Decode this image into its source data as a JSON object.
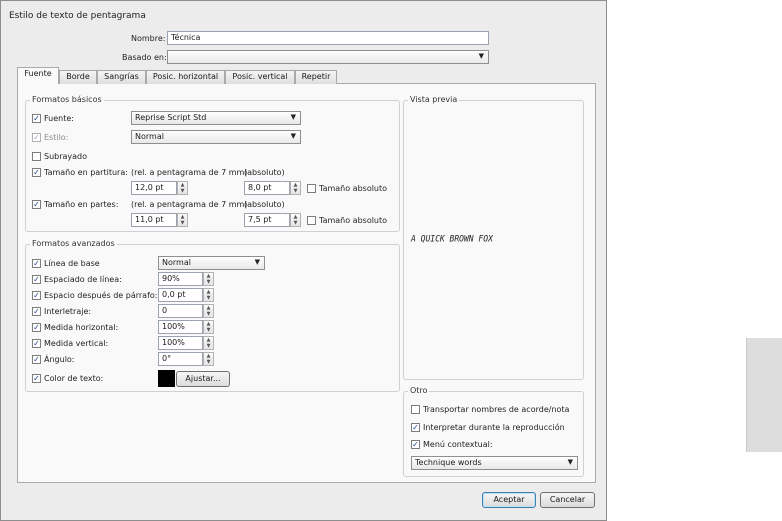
{
  "window": {
    "title": "Estilo de texto de pentagrama"
  },
  "header": {
    "name_label": "Nombre:",
    "name_value": "Técnica",
    "based_on_label": "Basado en:",
    "based_on_value": ""
  },
  "tabs": [
    {
      "label": "Fuente"
    },
    {
      "label": "Borde"
    },
    {
      "label": "Sangrías"
    },
    {
      "label": "Posic. horizontal"
    },
    {
      "label": "Posic. vertical"
    },
    {
      "label": "Repetir"
    }
  ],
  "basic": {
    "title": "Formatos básicos",
    "font_label": "Fuente:",
    "font_value": "Reprise Script Std",
    "style_label": "Estilo:",
    "style_value": "Normal",
    "underline_label": "Subrayado",
    "score_size_label": "Tamaño en partitura:",
    "parts_size_label": "Tamaño en partes:",
    "rel_note": "(rel. a pentagrama de 7 mm)",
    "abs_note": "(absoluto)",
    "score_rel_value": "12,0 pt",
    "score_abs_value": "8,0 pt",
    "parts_rel_value": "11,0 pt",
    "parts_abs_value": "7,5 pt",
    "absolute_size_label": "Tamaño absoluto"
  },
  "advanced": {
    "title": "Formatos avanzados",
    "baseline_label": "Línea de base",
    "baseline_value": "Normal",
    "line_spacing_label": "Espaciado de línea:",
    "line_spacing_value": "90%",
    "para_space_label": "Espacio después de párrafo:",
    "para_space_value": "0,0 pt",
    "kerning_label": "Interletraje:",
    "kerning_value": "0",
    "hscale_label": "Medida horizontal:",
    "hscale_value": "100%",
    "vscale_label": "Medida vertical:",
    "vscale_value": "100%",
    "angle_label": "Ángulo:",
    "angle_value": "0°",
    "color_label": "Color de texto:",
    "adjust_label": "Ajustar...",
    "text_color": "#000000"
  },
  "preview": {
    "title": "Vista previa",
    "sample": "A QUICK BROWN FOX"
  },
  "other": {
    "title": "Otro",
    "transport_label": "Transportar nombres de acorde/nota",
    "interpret_label": "Interpretar durante la reproducción",
    "context_label": "Menú contextual:",
    "context_value": "Technique words"
  },
  "footer": {
    "accept_label": "Aceptar",
    "cancel_label": "Cancelar"
  },
  "icons": {
    "check": "✓",
    "dropdown": "▼",
    "spin_up": "▲",
    "spin_down": "▼"
  }
}
